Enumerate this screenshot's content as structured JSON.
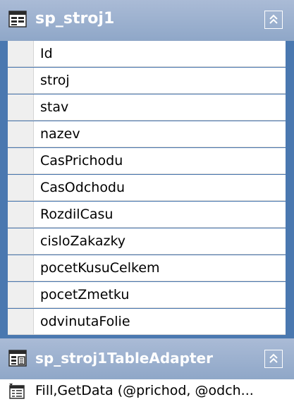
{
  "table": {
    "title": "sp_stroj1",
    "columns": [
      {
        "name": "Id"
      },
      {
        "name": "stroj"
      },
      {
        "name": "stav"
      },
      {
        "name": "nazev"
      },
      {
        "name": "CasPrichodu"
      },
      {
        "name": "CasOdchodu"
      },
      {
        "name": "RozdilCasu"
      },
      {
        "name": "cisloZakazky"
      },
      {
        "name": "pocetKusuCelkem"
      },
      {
        "name": "pocetZmetku"
      },
      {
        "name": "odvinutaFolie"
      }
    ]
  },
  "adapter": {
    "title": "sp_stroj1TableAdapter",
    "query": "Fill,GetData (@prichod, @odch..."
  },
  "icons": {
    "table_icon": "datatable-icon",
    "adapter_icon": "tableadapter-icon",
    "query_icon": "query-icon",
    "collapse_icon": "double-chevron-up-icon"
  },
  "colors": {
    "frame": "#4a78b0",
    "header": "#8fa7c8",
    "row_bg": "#ffffff"
  }
}
